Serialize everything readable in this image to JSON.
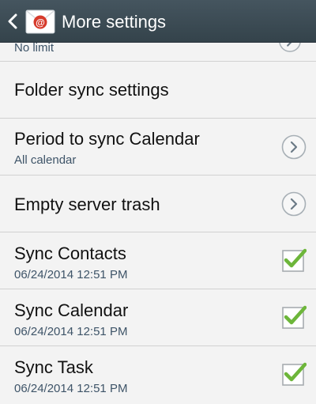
{
  "header": {
    "title": "More settings",
    "app_icon_glyph": "@",
    "accent_color": "#d63a2b"
  },
  "rows": [
    {
      "subtitle": "No limit",
      "icon": "chevron-right-icon"
    },
    {
      "title": "Folder sync settings"
    },
    {
      "title": "Period to sync Calendar",
      "subtitle": "All calendar",
      "icon": "chevron-right-icon"
    },
    {
      "title": "Empty server trash",
      "icon": "chevron-right-icon"
    },
    {
      "title": "Sync Contacts",
      "subtitle": "06/24/2014 12:51 PM",
      "checked": true,
      "icon": "checkmark-icon"
    },
    {
      "title": "Sync Calendar",
      "subtitle": "06/24/2014 12:51 PM",
      "checked": true,
      "icon": "checkmark-icon"
    },
    {
      "title": "Sync Task",
      "subtitle": "06/24/2014 12:51 PM",
      "checked": true,
      "icon": "checkmark-icon"
    }
  ],
  "colors": {
    "header_bg": "#3b4a54",
    "check_green": "#6db63a",
    "subtitle_blue": "#3e5468"
  }
}
